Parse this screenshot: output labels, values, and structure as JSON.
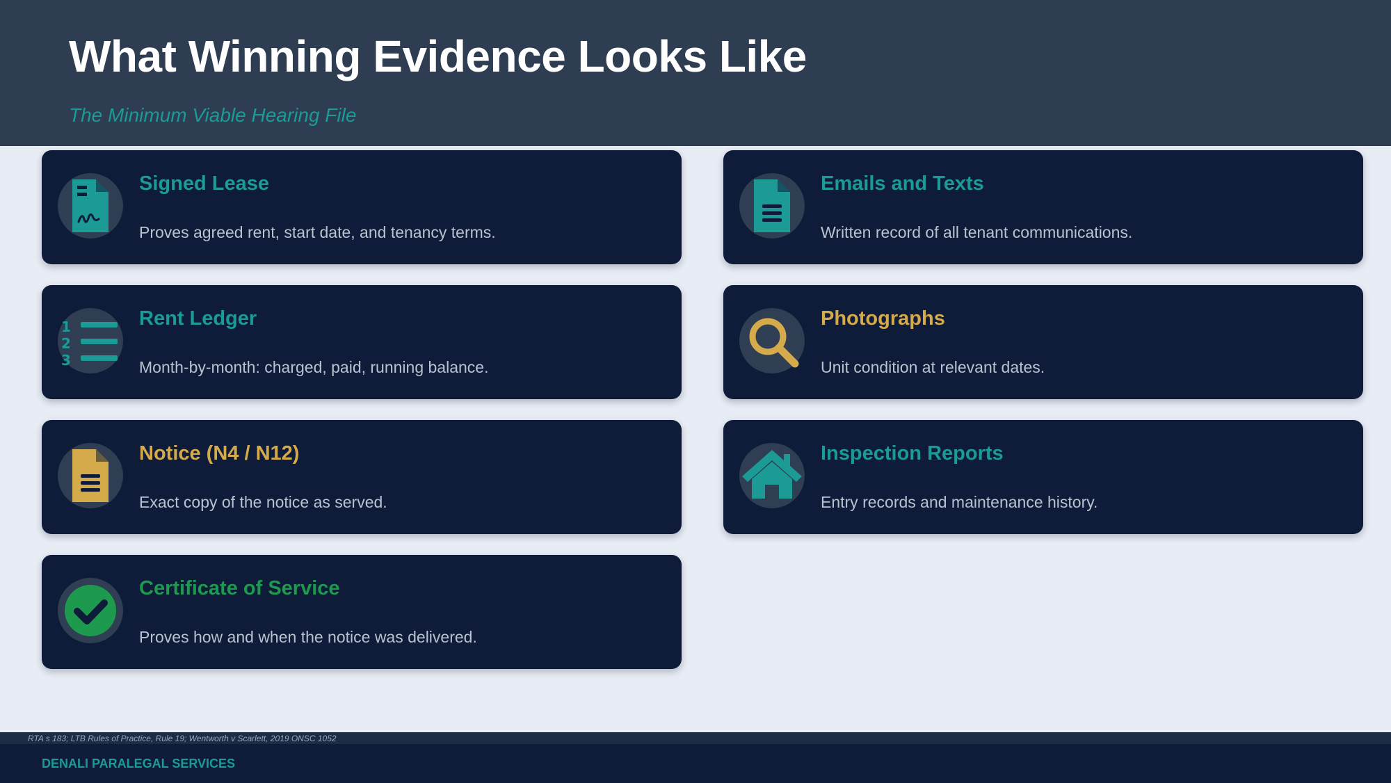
{
  "header": {
    "title": "What Winning Evidence Looks Like",
    "subtitle": "The Minimum Viable Hearing File"
  },
  "cards": [
    {
      "title": "Signed Lease",
      "description": "Proves agreed rent, start date, and tenancy terms.",
      "icon": "signed-document-icon",
      "accent": "#1b9a96"
    },
    {
      "title": "Emails and Texts",
      "description": "Written record of all tenant communications.",
      "icon": "document-icon",
      "accent": "#1b9a96"
    },
    {
      "title": "Rent Ledger",
      "description": "Month-by-month: charged, paid, running balance.",
      "icon": "numbered-list-icon",
      "accent": "#1b9a96"
    },
    {
      "title": "Photographs",
      "description": "Unit condition at relevant dates.",
      "icon": "magnifier-icon",
      "accent": "#d4aa4a"
    },
    {
      "title": "Notice (N4 / N12)",
      "description": "Exact copy of the notice as served.",
      "icon": "notice-document-icon",
      "accent": "#d4aa4a"
    },
    {
      "title": "Inspection Reports",
      "description": "Entry records and maintenance history.",
      "icon": "house-icon",
      "accent": "#1b9a96"
    },
    {
      "title": "Certificate of Service",
      "description": "Proves how and when the notice was delivered.",
      "icon": "check-circle-icon",
      "accent": "#1e9a4e"
    }
  ],
  "footer": {
    "citation": "RTA s 183; LTB Rules of Practice, Rule 19; Wentworth v Scarlett, 2019 ONSC 1052",
    "brand": "DENALI PARALEGAL SERVICES"
  },
  "colors": {
    "header_bg": "#2e3d51",
    "card_bg": "#0e1c3a",
    "teal": "#1b9a96",
    "gold": "#d4aa4a",
    "green": "#1e9a4e",
    "page_bg": "#e8ecf4"
  }
}
